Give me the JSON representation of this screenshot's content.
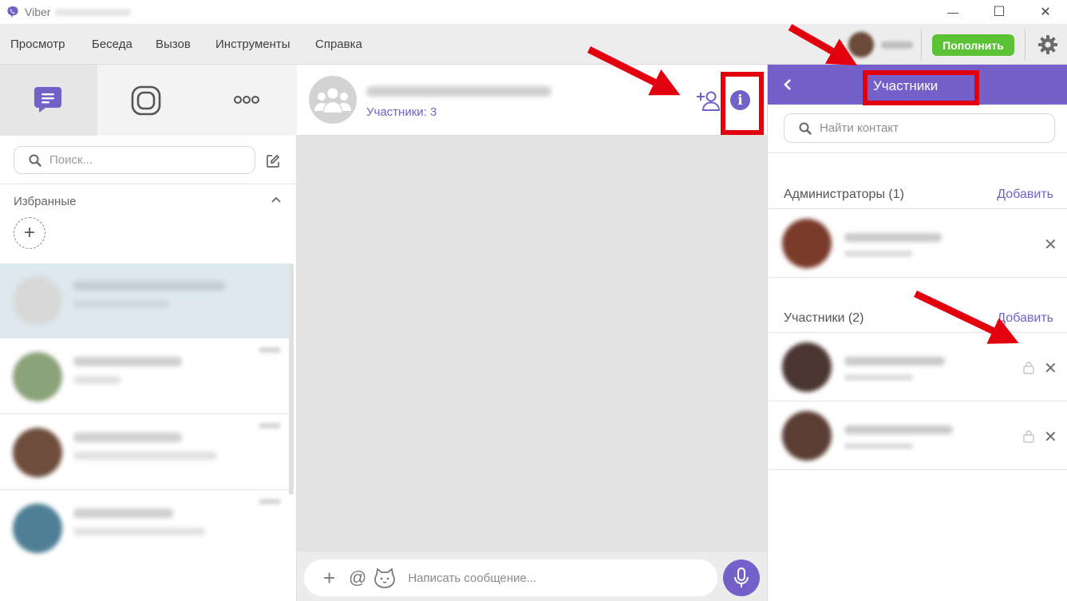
{
  "window": {
    "app_title": "Viber",
    "minimize": "—",
    "maximize": "☐",
    "close": "✕"
  },
  "menu": {
    "items": [
      "Просмотр",
      "Беседа",
      "Вызов",
      "Инструменты",
      "Справка"
    ],
    "topup_label": "Пополнить"
  },
  "left": {
    "search_placeholder": "Поиск...",
    "favorites_label": "Избранные",
    "add_favorite": "+"
  },
  "chat": {
    "participants_line": "Участники: 3",
    "message_placeholder": "Написать сообщение...",
    "plus": "+",
    "at": "@",
    "info_label": "i"
  },
  "panel": {
    "title": "Участники",
    "search_placeholder": "Найти контакт",
    "admins_title": "Администраторы (1)",
    "admins_add": "Добавить",
    "members_title": "Участники (2)",
    "members_add": "Добавить",
    "remove": "✕"
  },
  "colors": {
    "accent": "#7360c9",
    "topup": "#5bc236",
    "highlight": "#e2000f",
    "selected_chat": "#dde9ef"
  }
}
